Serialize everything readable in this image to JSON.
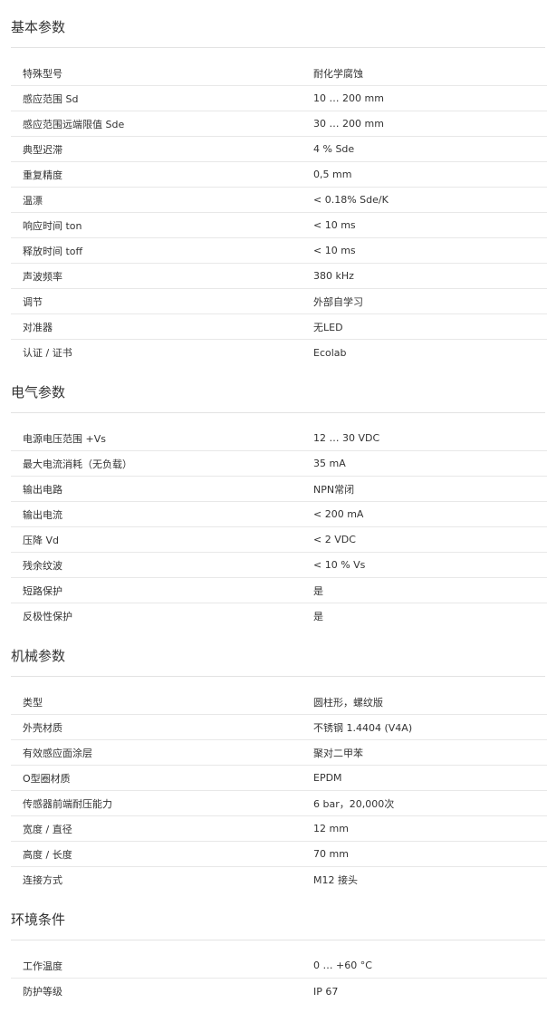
{
  "sections": [
    {
      "title": "基本参数",
      "rows": [
        {
          "label": "特殊型号",
          "value": "耐化学腐蚀"
        },
        {
          "label": "感应范围 Sd",
          "value": "10 … 200 mm"
        },
        {
          "label": "感应范围远端限值 Sde",
          "value": "30 … 200 mm"
        },
        {
          "label": "典型迟滞",
          "value": "4 % Sde"
        },
        {
          "label": "重复精度",
          "value": "0,5 mm"
        },
        {
          "label": "温漂",
          "value": "< 0.18% Sde/K"
        },
        {
          "label": "响应时间 ton",
          "value": "< 10 ms"
        },
        {
          "label": "释放时间 toff",
          "value": "< 10 ms"
        },
        {
          "label": "声波频率",
          "value": "380 kHz"
        },
        {
          "label": "调节",
          "value": "外部自学习"
        },
        {
          "label": "对准器",
          "value": "无LED"
        },
        {
          "label": "认证 / 证书",
          "value": "Ecolab"
        }
      ]
    },
    {
      "title": "电气参数",
      "rows": [
        {
          "label": "电源电压范围 +Vs",
          "value": "12 … 30 VDC"
        },
        {
          "label": "最大电流消耗（无负载）",
          "value": "35 mA"
        },
        {
          "label": "输出电路",
          "value": "NPN常闭"
        },
        {
          "label": "输出电流",
          "value": "< 200 mA"
        },
        {
          "label": "压降 Vd",
          "value": "< 2 VDC"
        },
        {
          "label": "残余纹波",
          "value": "< 10 % Vs"
        },
        {
          "label": "短路保护",
          "value": "是"
        },
        {
          "label": "反极性保护",
          "value": "是"
        }
      ]
    },
    {
      "title": "机械参数",
      "rows": [
        {
          "label": "类型",
          "value": "圆柱形，螺纹版"
        },
        {
          "label": "外壳材质",
          "value": "不锈钢 1.4404 (V4A)"
        },
        {
          "label": "有效感应面涂层",
          "value": "聚对二甲苯"
        },
        {
          "label": "O型圈材质",
          "value": "EPDM"
        },
        {
          "label": "传感器前端耐压能力",
          "value": "6 bar，20,000次"
        },
        {
          "label": "宽度 / 直径",
          "value": "12 mm"
        },
        {
          "label": "高度 / 长度",
          "value": "70 mm"
        },
        {
          "label": "连接方式",
          "value": "M12 接头"
        }
      ]
    },
    {
      "title": "环境条件",
      "rows": [
        {
          "label": "工作温度",
          "value": "0 … +60 °C"
        },
        {
          "label": "防护等级",
          "value": "IP 67"
        }
      ]
    }
  ]
}
